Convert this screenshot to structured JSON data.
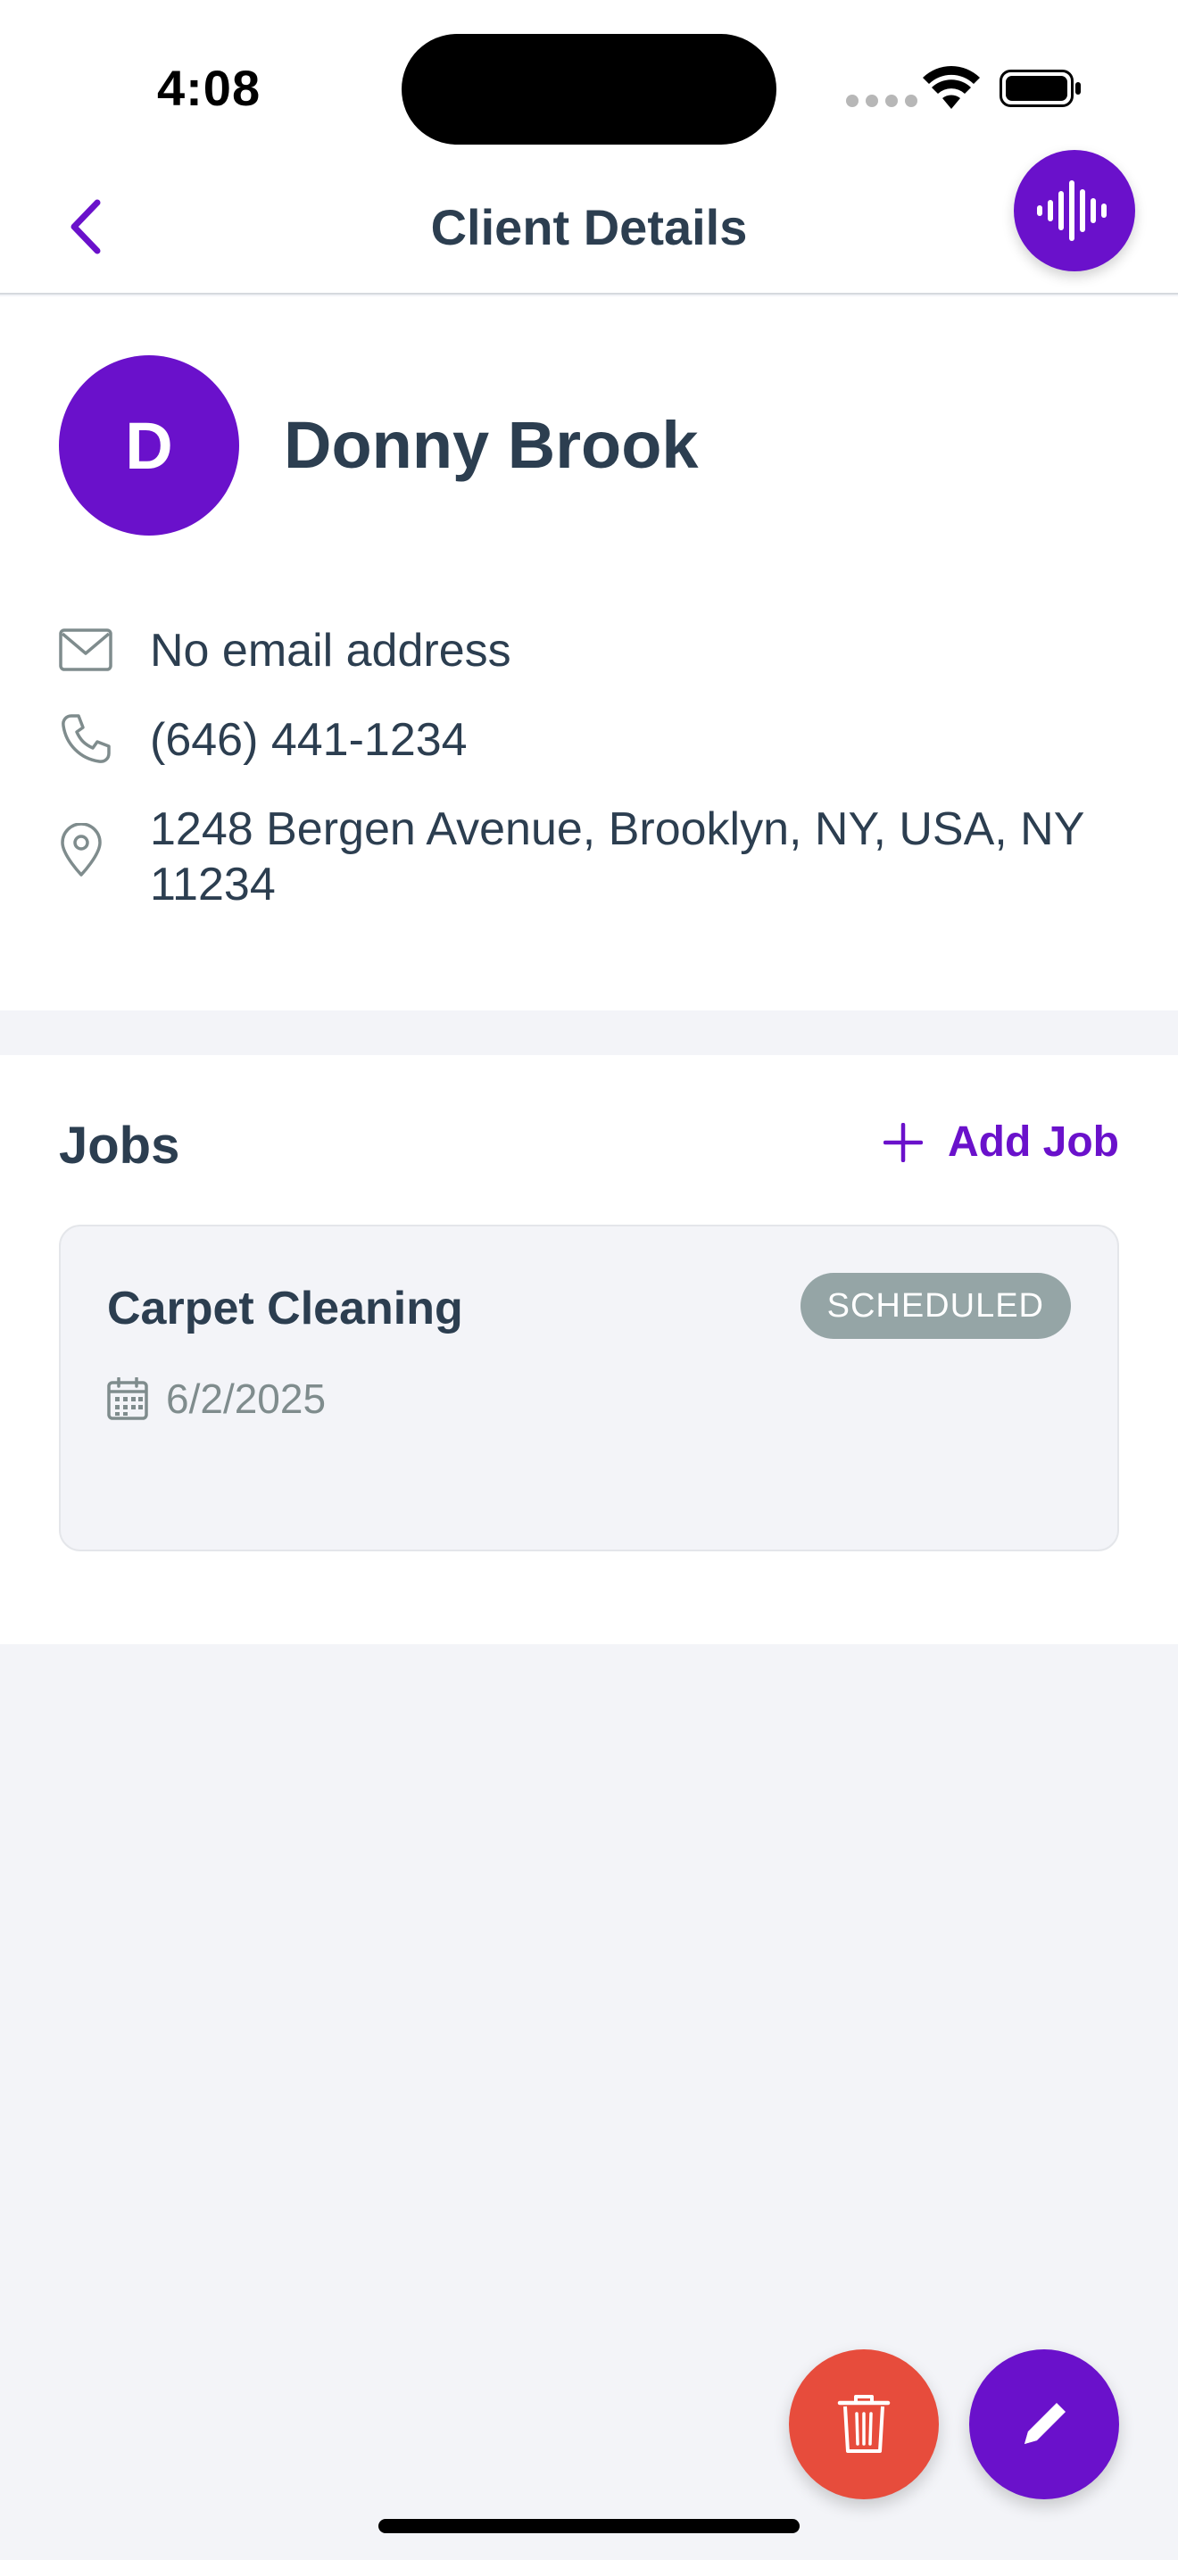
{
  "status_bar": {
    "time": "4:08"
  },
  "nav": {
    "title": "Client Details"
  },
  "client": {
    "initial": "D",
    "name": "Donny Brook",
    "email": "No email address",
    "phone": "(646) 441-1234",
    "address": "1248 Bergen Avenue, Brooklyn, NY, USA, NY 11234"
  },
  "jobs": {
    "title": "Jobs",
    "add_label": "Add Job",
    "items": [
      {
        "name": "Carpet Cleaning",
        "status": "SCHEDULED",
        "date": "6/2/2025"
      }
    ]
  },
  "colors": {
    "accent": "#6a11cb",
    "danger": "#e74c3c",
    "status_scheduled": "#95a5a6",
    "text": "#2c3e50"
  },
  "icons": {
    "back": "chevron-left-icon",
    "voice": "audio-wave-icon",
    "email": "envelope-icon",
    "phone": "phone-icon",
    "address": "map-pin-icon",
    "add": "plus-icon",
    "date": "calendar-icon",
    "delete": "trash-icon",
    "edit": "pencil-icon"
  }
}
